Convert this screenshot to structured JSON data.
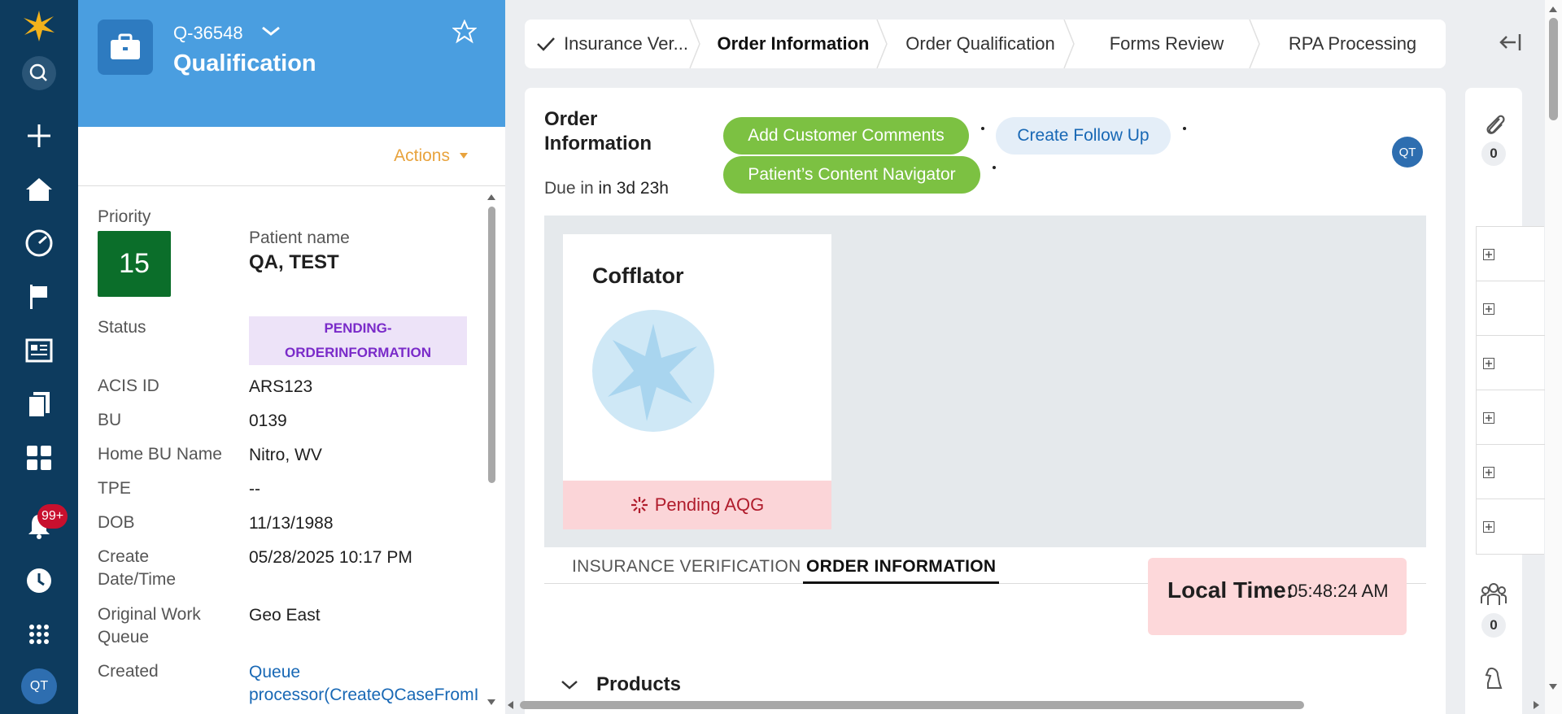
{
  "nav": {
    "icons": [
      "logo-icon",
      "search-icon",
      "plus-icon",
      "home-icon",
      "dashboard-icon",
      "flag-icon",
      "news-icon",
      "documents-icon",
      "apps-grid-icon",
      "bell-icon",
      "history-icon",
      "launcher-icon"
    ],
    "notifications_badge": "99+",
    "avatar_initials": "QT"
  },
  "case": {
    "id": "Q-36548",
    "title": "Qualification",
    "actions_label": "Actions",
    "fields": {
      "priority_label": "Priority",
      "priority_value": "15",
      "patient_name_label": "Patient name",
      "patient_name_value": "QA, TEST",
      "status_label": "Status",
      "status_value_line1": "PENDING-",
      "status_value_line2": "ORDERINFORMATION",
      "acis_label": "ACIS ID",
      "acis_value": "ARS123",
      "bu_label": "BU",
      "bu_value": "0139",
      "home_bu_label": "Home BU Name",
      "home_bu_value": "Nitro, WV",
      "tpe_label": "TPE",
      "tpe_value": "--",
      "dob_label": "DOB",
      "dob_value": "11/13/1988",
      "create_label_line1": "Create",
      "create_label_line2": "Date/Time",
      "create_value": "05/28/2025 10:17 PM",
      "owq_label_line1": "Original Work",
      "owq_label_line2": "Queue",
      "owq_value": "Geo East",
      "created_label": "Created",
      "created_value_line1": "Queue",
      "created_value_line2": "processor(CreateQCaseFromI"
    }
  },
  "stages": [
    {
      "label": "Insurance Ver...",
      "done": true
    },
    {
      "label": "Order Information",
      "active": true
    },
    {
      "label": "Order Qualification"
    },
    {
      "label": "Forms Review"
    },
    {
      "label": "RPA Processing"
    }
  ],
  "main": {
    "title": "Order Information",
    "due_prefix": "Due in",
    "due_value": "in 3d 23h",
    "buttons": {
      "add_comments": "Add Customer Comments",
      "create_follow_up": "Create Follow Up",
      "content_navigator": "Patient’s Content Navigator"
    },
    "assignee_initials": "QT",
    "product": {
      "name": "Cofflator",
      "status": "Pending AQG"
    },
    "tabs": [
      "INSURANCE VERIFICATION",
      "ORDER INFORMATION"
    ],
    "active_tab": "ORDER INFORMATION",
    "local_time_label": "Local Time:",
    "local_time_value": "05:48:24 AM",
    "section_products": "Products"
  },
  "utility": {
    "attachments_count": "0",
    "followers_count": "0"
  },
  "colors": {
    "nav_bg": "#0d3b5e",
    "header_blue": "#4a9ee0",
    "priority_green": "#0b6e2a",
    "action_green": "#7cc142",
    "status_purple": "#7a2bc9",
    "pending_red": "#b01c2c",
    "actions_orange": "#e8a33d"
  }
}
